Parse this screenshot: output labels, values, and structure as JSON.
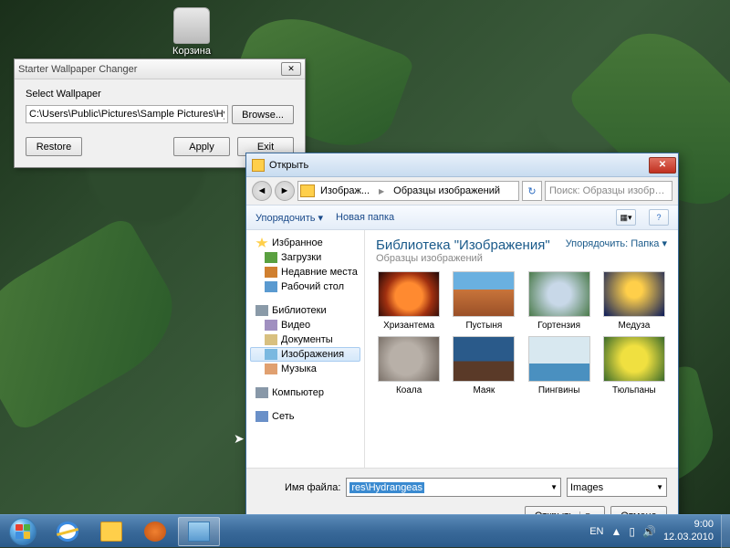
{
  "desktop": {
    "recycle_label": "Корзина"
  },
  "changer": {
    "title": "Starter Wallpaper Changer",
    "select_label": "Select Wallpaper",
    "path": "C:\\Users\\Public\\Pictures\\Sample Pictures\\Hydrangeas.jp",
    "browse": "Browse...",
    "restore": "Restore",
    "apply": "Apply",
    "exit": "Exit"
  },
  "dlg": {
    "title": "Открыть",
    "crumb1": "Изображ...",
    "crumb2": "Образцы изображений",
    "search_placeholder": "Поиск: Образцы изображений",
    "toolbar": {
      "organize": "Упорядочить ▾",
      "newfolder": "Новая папка"
    },
    "tree": {
      "fav": "Избранное",
      "dl": "Загрузки",
      "recent": "Недавние места",
      "desk": "Рабочий стол",
      "libs": "Библиотеки",
      "vid": "Видео",
      "doc": "Документы",
      "img": "Изображения",
      "mus": "Музыка",
      "comp": "Компьютер",
      "net": "Сеть"
    },
    "lib": {
      "title": "Библиотека \"Изображения\"",
      "sub": "Образцы изображений",
      "sort": "Упорядочить:",
      "sortval": "Папка ▾"
    },
    "thumbs": [
      "Хризантема",
      "Пустыня",
      "Гортензия",
      "Медуза",
      "Коала",
      "Маяк",
      "Пингвины",
      "Тюльпаны"
    ],
    "file_label": "Имя файла:",
    "file_value": "res\\Hydrangeas",
    "filter": "Images",
    "open": "Открыть",
    "cancel": "Отмена"
  },
  "tray": {
    "lang": "EN",
    "time": "9:00",
    "date": "12.03.2010"
  }
}
